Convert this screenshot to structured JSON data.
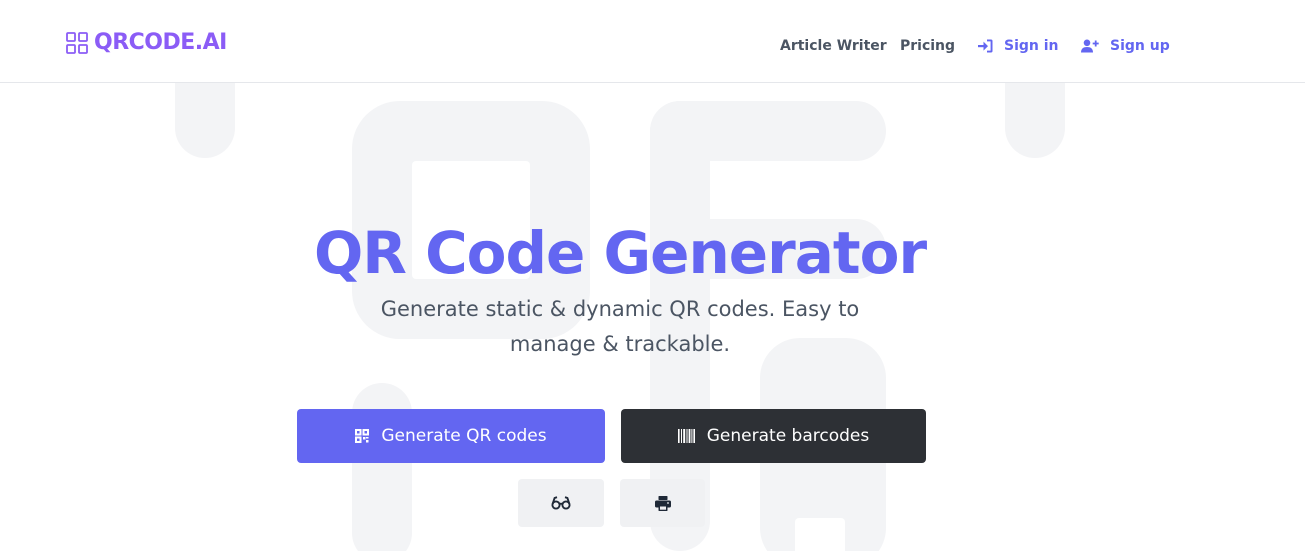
{
  "header": {
    "logo_text": "QRCODE.AI",
    "nav": {
      "article_writer": "Article Writer",
      "pricing": "Pricing",
      "sign_in": "Sign in",
      "sign_up": "Sign up"
    }
  },
  "hero": {
    "title": "QR Code Generator",
    "subtitle": "Generate static & dynamic QR codes. Easy to manage & trackable.",
    "buttons": {
      "generate_qr": "Generate QR codes",
      "generate_barcodes": "Generate barcodes"
    },
    "icon_buttons": [
      "glasses-icon",
      "printer-icon"
    ]
  },
  "colors": {
    "accent": "#6366f1",
    "logo": "#8b5cf6",
    "dark_button": "#2d3035",
    "muted_text": "#4b5563"
  }
}
